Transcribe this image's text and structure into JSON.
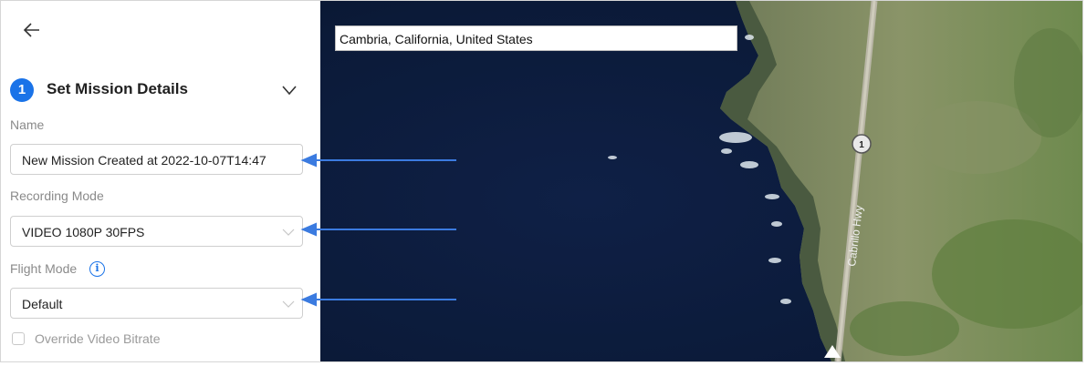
{
  "panel": {
    "step_number": "1",
    "step_title": "Set Mission Details",
    "name_label": "Name",
    "name_value": "New Mission Created at 2022-10-07T14:47",
    "recording_label": "Recording Mode",
    "recording_value": "VIDEO 1080P 30FPS",
    "flight_label": "Flight Mode",
    "flight_value": "Default",
    "override_label": "Override Video Bitrate"
  },
  "map": {
    "search_value": "Cambria, California, United States",
    "road_label": "Cabrillo Hwy",
    "road_shield": "1"
  },
  "colors": {
    "accent": "#1a73e8",
    "arrow": "#3b7be0",
    "ocean": "#0d1c3a",
    "land": "#7f8a62"
  }
}
